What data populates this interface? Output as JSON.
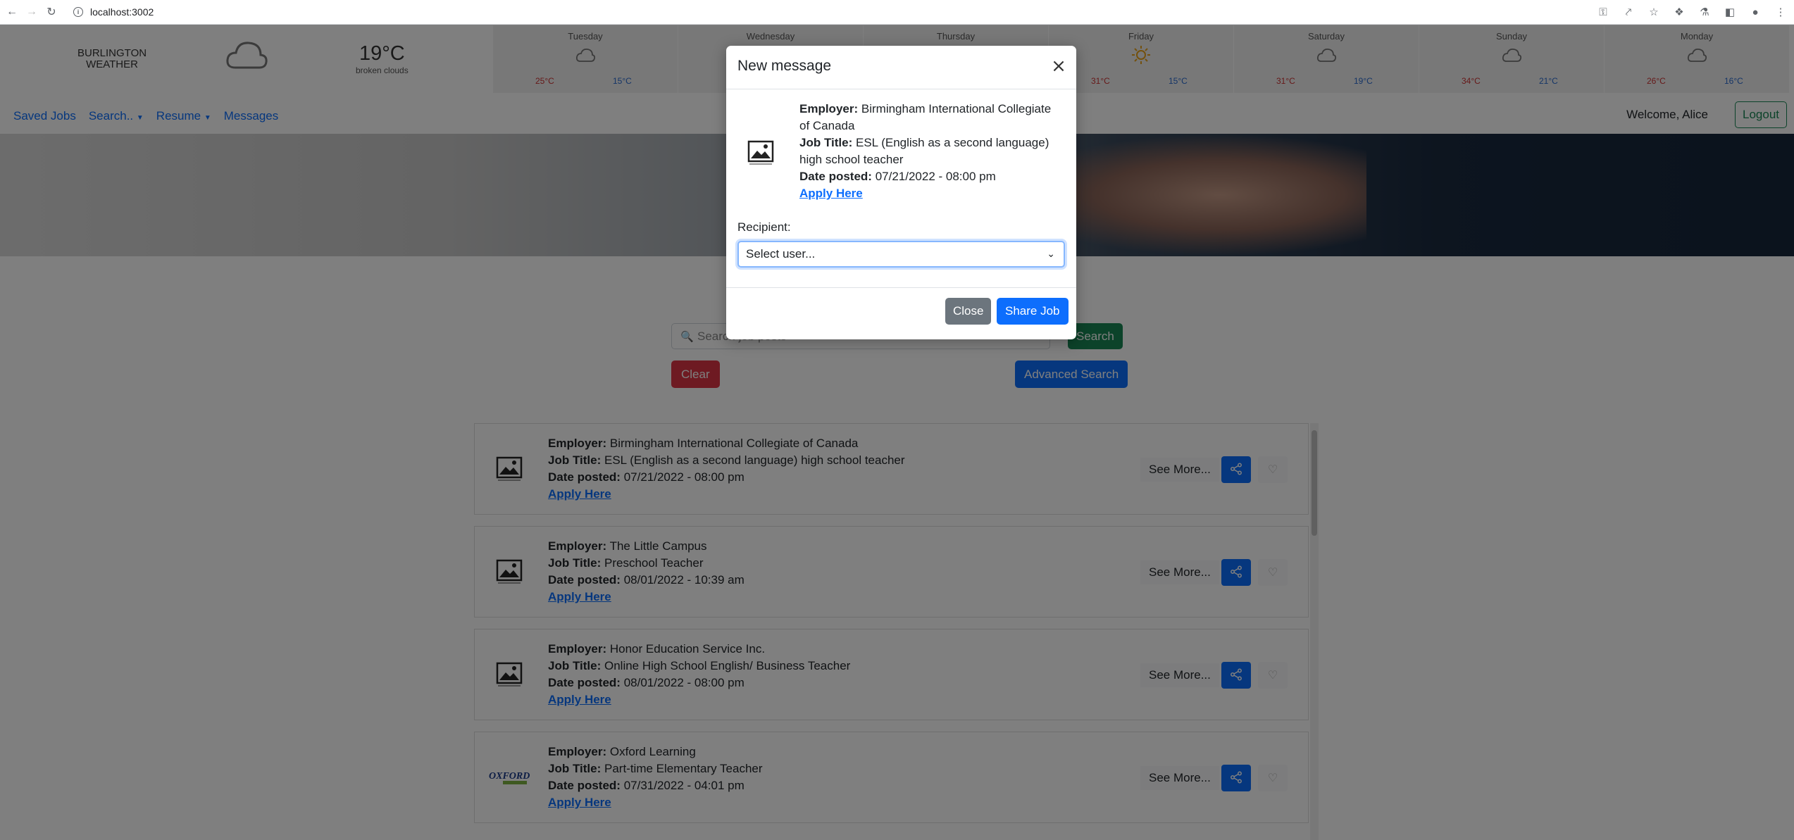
{
  "browser": {
    "url": "localhost:3002"
  },
  "weather": {
    "city_line1": "BURLINGTON",
    "city_line2": "WEATHER",
    "current_icon": "cloud-icon",
    "current_temp": "19°C",
    "current_desc": "broken clouds",
    "days": [
      {
        "name": "Tuesday",
        "icon": "cloud-icon",
        "hi": "25°C",
        "lo": "15°C"
      },
      {
        "name": "Wednesday",
        "icon": "cloud-icon",
        "hi": "",
        "lo": ""
      },
      {
        "name": "Thursday",
        "icon": "cloud-icon",
        "hi": "",
        "lo": ""
      },
      {
        "name": "Friday",
        "icon": "sun-icon",
        "hi": "31°C",
        "lo": "15°C"
      },
      {
        "name": "Saturday",
        "icon": "cloud-icon",
        "hi": "31°C",
        "lo": "19°C"
      },
      {
        "name": "Sunday",
        "icon": "cloud-icon",
        "hi": "34°C",
        "lo": "21°C"
      },
      {
        "name": "Monday",
        "icon": "cloud-icon",
        "hi": "26°C",
        "lo": "16°C"
      }
    ]
  },
  "navbar": {
    "links": [
      "Saved Jobs",
      "Search..",
      "Resume",
      "Messages"
    ],
    "welcome": "Welcome, Alice",
    "logout": "Logout"
  },
  "search": {
    "placeholder": "Search job posts",
    "search_label": "Search",
    "clear_label": "Clear",
    "advanced_label": "Advanced Search"
  },
  "jobs": [
    {
      "employer": "Birmingham International Collegiate of Canada",
      "title": "ESL (English as a second language) high school teacher",
      "date": "07/21/2022 - 08:00 pm",
      "apply": "Apply Here",
      "logo": "image-placeholder-icon"
    },
    {
      "employer": "The Little Campus",
      "title": "Preschool Teacher",
      "date": "08/01/2022 - 10:39 am",
      "apply": "Apply Here",
      "logo": "image-placeholder-icon"
    },
    {
      "employer": "Honor Education Service Inc.",
      "title": "Online High School English/ Business Teacher",
      "date": "08/01/2022 - 08:00 pm",
      "apply": "Apply Here",
      "logo": "image-placeholder-icon"
    },
    {
      "employer": "Oxford Learning",
      "title": "Part-time Elementary Teacher",
      "date": "07/31/2022 - 04:01 pm",
      "apply": "Apply Here",
      "logo": "oxford-logo"
    }
  ],
  "job_labels": {
    "employer": "Employer:",
    "title": "Job Title:",
    "date": "Date posted:",
    "see_more": "See More..."
  },
  "modal": {
    "title": "New message",
    "employer_label": "Employer:",
    "employer": "Birmingham International Collegiate of Canada",
    "title_label": "Job Title:",
    "job_title": "ESL (English as a second language) high school teacher",
    "date_label": "Date posted:",
    "date": "07/21/2022 - 08:00 pm",
    "apply": "Apply Here",
    "recipient_label": "Recipient:",
    "select_value": "Select user...",
    "close_label": "Close",
    "share_label": "Share Job"
  },
  "colors": {
    "primary": "#0d6efd",
    "success": "#198754",
    "danger": "#dc3545",
    "secondary": "#6c757d"
  }
}
